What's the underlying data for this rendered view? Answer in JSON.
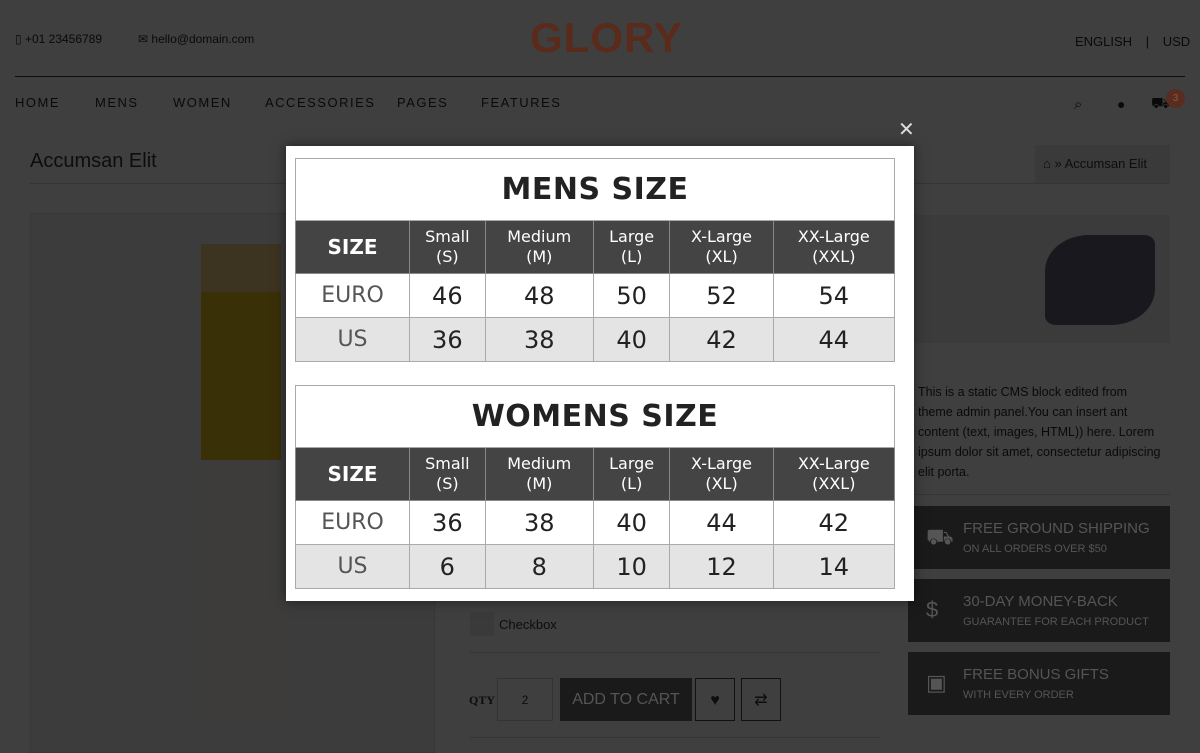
{
  "header": {
    "phone": "+01 23456789",
    "email": "hello@domain.com",
    "logo": "GLORY",
    "language": "ENGLISH",
    "currency": "USD",
    "cart_count": "3"
  },
  "nav": [
    "HOME",
    "MENS",
    "WOMEN",
    "ACCESSORIES",
    "PAGES",
    "FEATURES"
  ],
  "page": {
    "title": "Accumsan Elit",
    "breadcrumb": [
      "home-icon",
      "Accumsan Elit"
    ],
    "breadcrumb_sep": "»"
  },
  "cms_text": "This is a static CMS block edited from theme admin panel.You can insert ant content (text, images, HTML)) here. Lorem ipsum dolor sit amet, consectetur adipiscing elit porta.",
  "features": [
    {
      "icon": "truck-icon",
      "title": "FREE GROUND SHIPPING",
      "subtitle": "ON ALL ORDERS OVER $50"
    },
    {
      "icon": "dollar-icon",
      "title": "30-DAY MONEY-BACK",
      "subtitle": "GUARANTEE FOR EACH PRODUCT"
    },
    {
      "icon": "gift-icon",
      "title": "FREE BONUS GIFTS",
      "subtitle": "WITH EVERY ORDER"
    }
  ],
  "product": {
    "checkbox_label": "Checkbox",
    "qty_label": "QTY",
    "qty": "2",
    "add_to_cart": "ADD TO CART"
  },
  "size_chart": {
    "mens": {
      "title": "MENS SIZE",
      "headers": [
        "SIZE",
        "Small\n(S)",
        "Medium\n(M)",
        "Large\n(L)",
        "X-Large\n(XL)",
        "XX-Large\n(XXL)"
      ],
      "rows": [
        [
          "EURO",
          "46",
          "48",
          "50",
          "52",
          "54"
        ],
        [
          "US",
          "36",
          "38",
          "40",
          "42",
          "44"
        ]
      ]
    },
    "womens": {
      "title": "WOMENS SIZE",
      "headers": [
        "SIZE",
        "Small\n(S)",
        "Medium\n(M)",
        "Large\n(L)",
        "X-Large\n(XL)",
        "XX-Large\n(XXL)"
      ],
      "rows": [
        [
          "EURO",
          "36",
          "38",
          "40",
          "44",
          "42"
        ],
        [
          "US",
          "6",
          "8",
          "10",
          "12",
          "14"
        ]
      ]
    }
  },
  "colors": {
    "accent": "#c0572f",
    "header_cell": "#444444",
    "us_row": "#e4e4e4"
  }
}
